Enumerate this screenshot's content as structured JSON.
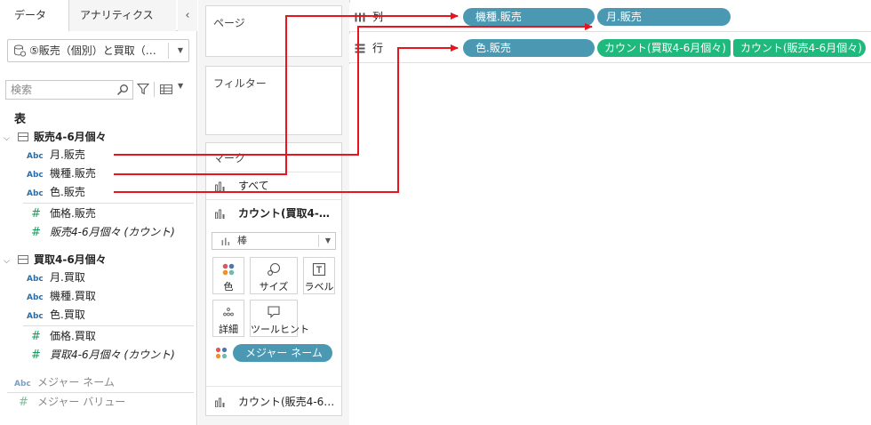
{
  "colors": {
    "dimension_pill": "#4a98b2",
    "measure_pill": "#1fb87d",
    "arrow": "#e8141e",
    "abc_text": "#2e6da4",
    "measure_hash": "#1a9b5e"
  },
  "left_pane": {
    "tabs": {
      "data": "データ",
      "analytics": "アナリティクス",
      "collapse_glyph": "‹"
    },
    "datasource": {
      "label": "⑤販売（個別）と買取（…",
      "icon": "datasource-icon",
      "arrow": "▼"
    },
    "search": {
      "placeholder": "検索",
      "filter_icon": "filter-icon",
      "view_icon": "list-view-icon",
      "arrow": "▼"
    },
    "section_title": "表",
    "tables": [
      {
        "name": "販売4-6月個々",
        "chevron": "⌵",
        "fields": [
          {
            "type_label": "Abc",
            "name": "月.販売"
          },
          {
            "type_label": "Abc",
            "name": "機種.販売"
          },
          {
            "type_label": "Abc",
            "name": "色.販売"
          },
          {
            "type_label": "#",
            "name": "価格.販売"
          },
          {
            "type_label": "#",
            "name": "販売4-6月個々 (カウント)"
          }
        ]
      },
      {
        "name": "買取4-6月個々",
        "chevron": "⌵",
        "fields": [
          {
            "type_label": "Abc",
            "name": "月.買取"
          },
          {
            "type_label": "Abc",
            "name": "機種.買取"
          },
          {
            "type_label": "Abc",
            "name": "色.買取"
          },
          {
            "type_label": "#",
            "name": "価格.買取"
          },
          {
            "type_label": "#",
            "name": "買取4-6月個々 (カウント)"
          }
        ]
      }
    ],
    "extra_fields": [
      {
        "type_label": "Abc",
        "name": "メジャー ネーム"
      },
      {
        "type_label": "#",
        "name": "メジャー バリュー"
      }
    ]
  },
  "cards": {
    "pages": "ページ",
    "filters": "フィルター",
    "marks": {
      "title": "マーク",
      "all": "すべて",
      "count_buy": "カウント(買取4-…",
      "mark_type": "棒",
      "mark_type_arrow": "▼",
      "buttons": {
        "color": "色",
        "size": "サイズ",
        "label": "ラベル",
        "detail": "詳細",
        "tooltip": "ツールヒント"
      },
      "measure_names_pill": "メジャー ネーム",
      "count_sell": "カウント(販売4-6…"
    }
  },
  "shelves": {
    "columns": {
      "label": "列",
      "pills": [
        "機種.販売",
        "月.販売"
      ]
    },
    "rows": {
      "label": "行",
      "pills": [
        "色.販売"
      ],
      "measure_pills": [
        "カウント(買取4-6月個々)",
        "カウント(販売4-6月個々)"
      ]
    }
  }
}
